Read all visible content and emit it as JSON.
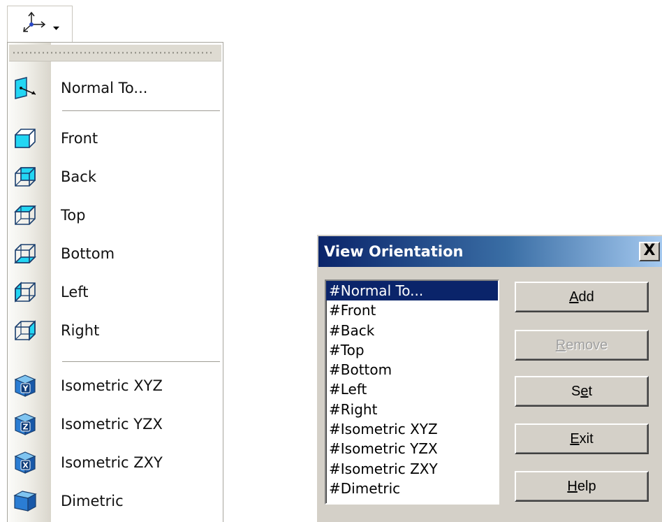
{
  "menu": {
    "items": [
      {
        "label": "Normal To...",
        "icon": "normal-to-icon"
      },
      {
        "label": "Front",
        "icon": "front-view-icon"
      },
      {
        "label": "Back",
        "icon": "back-view-icon"
      },
      {
        "label": "Top",
        "icon": "top-view-icon"
      },
      {
        "label": "Bottom",
        "icon": "bottom-view-icon"
      },
      {
        "label": "Left",
        "icon": "left-view-icon"
      },
      {
        "label": "Right",
        "icon": "right-view-icon"
      },
      {
        "label": "Isometric XYZ",
        "icon": "isometric-xyz-icon",
        "letter": "Y"
      },
      {
        "label": "Isometric YZX",
        "icon": "isometric-yzx-icon",
        "letter": "Z"
      },
      {
        "label": "Isometric ZXY",
        "icon": "isometric-zxy-icon",
        "letter": "X"
      },
      {
        "label": "Dimetric",
        "icon": "dimetric-icon"
      }
    ]
  },
  "toolbar": {
    "icon": "view-orientation-icon",
    "dropdown_icon": "dropdown-arrow-icon"
  },
  "dialog": {
    "title": "View Orientation",
    "close_label": "X",
    "list": [
      "#Normal To...",
      "#Front",
      "#Back",
      "#Top",
      "#Bottom",
      "#Left",
      "#Right",
      "#Isometric XYZ",
      "#Isometric YZX",
      "#Isometric ZXY",
      "#Dimetric"
    ],
    "selected": "#Normal To...",
    "buttons": {
      "add": {
        "mnemonic": "A",
        "rest": "dd"
      },
      "remove": {
        "mnemonic": "R",
        "rest": "emove",
        "disabled": true
      },
      "set": {
        "pre": "S",
        "mnemonic": "e",
        "rest": "t"
      },
      "exit": {
        "mnemonic": "E",
        "rest": "xit"
      },
      "help": {
        "mnemonic": "H",
        "rest": "elp"
      }
    }
  },
  "colors": {
    "title_start": "#0a246a",
    "title_end": "#a6caf0",
    "selection": "#0a246a",
    "face": "#d4d0c8",
    "cube_face": "#23d6f3",
    "iso_cube": "#2b7dd3"
  }
}
